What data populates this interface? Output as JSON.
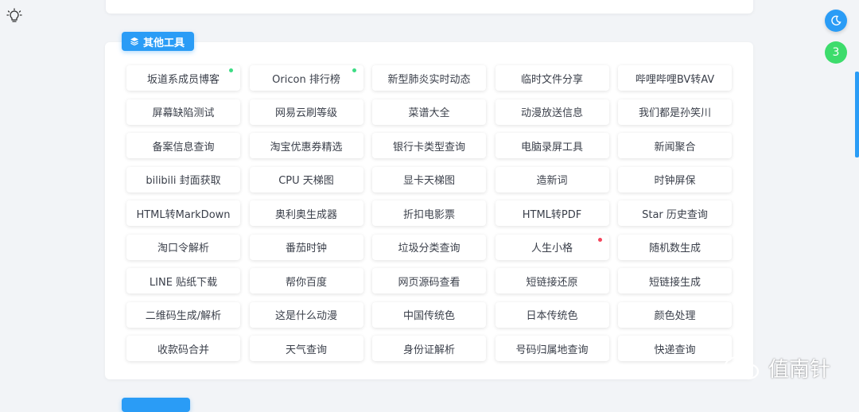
{
  "section": {
    "title": "其他工具",
    "icon": "layers-icon"
  },
  "tools": [
    {
      "label": "坂道系成员博客",
      "dot": "green"
    },
    {
      "label": "Oricon 排行榜",
      "dot": "green"
    },
    {
      "label": "新型肺炎实时动态",
      "dot": ""
    },
    {
      "label": "临时文件分享",
      "dot": ""
    },
    {
      "label": "哔哩哔哩BV转AV",
      "dot": ""
    },
    {
      "label": "屏幕缺陷测试",
      "dot": ""
    },
    {
      "label": "网易云刷等级",
      "dot": ""
    },
    {
      "label": "菜谱大全",
      "dot": ""
    },
    {
      "label": "动漫放送信息",
      "dot": ""
    },
    {
      "label": "我们都是孙笑川",
      "dot": ""
    },
    {
      "label": "备案信息查询",
      "dot": ""
    },
    {
      "label": "淘宝优惠券精选",
      "dot": ""
    },
    {
      "label": "银行卡类型查询",
      "dot": ""
    },
    {
      "label": "电脑录屏工具",
      "dot": ""
    },
    {
      "label": "新闻聚合",
      "dot": ""
    },
    {
      "label": "bilibili 封面获取",
      "dot": ""
    },
    {
      "label": "CPU 天梯图",
      "dot": ""
    },
    {
      "label": "显卡天梯图",
      "dot": ""
    },
    {
      "label": "造新词",
      "dot": ""
    },
    {
      "label": "时钟屏保",
      "dot": ""
    },
    {
      "label": "HTML转MarkDown",
      "dot": ""
    },
    {
      "label": "奥利奥生成器",
      "dot": ""
    },
    {
      "label": "折扣电影票",
      "dot": ""
    },
    {
      "label": "HTML转PDF",
      "dot": ""
    },
    {
      "label": "Star 历史查询",
      "dot": ""
    },
    {
      "label": "淘口令解析",
      "dot": ""
    },
    {
      "label": "番茄时钟",
      "dot": ""
    },
    {
      "label": "垃圾分类查询",
      "dot": ""
    },
    {
      "label": "人生小格",
      "dot": "red"
    },
    {
      "label": "随机数生成",
      "dot": ""
    },
    {
      "label": "LINE 贴纸下载",
      "dot": ""
    },
    {
      "label": "帮你百度",
      "dot": ""
    },
    {
      "label": "网页源码查看",
      "dot": ""
    },
    {
      "label": "短链接还原",
      "dot": ""
    },
    {
      "label": "短链接生成",
      "dot": ""
    },
    {
      "label": "二维码生成/解析",
      "dot": ""
    },
    {
      "label": "这是什么动漫",
      "dot": ""
    },
    {
      "label": "中国传统色",
      "dot": ""
    },
    {
      "label": "日本传统色",
      "dot": ""
    },
    {
      "label": "颜色处理",
      "dot": ""
    },
    {
      "label": "收款码合并",
      "dot": ""
    },
    {
      "label": "天气查询",
      "dot": ""
    },
    {
      "label": "身份证解析",
      "dot": ""
    },
    {
      "label": "号码归属地查询",
      "dot": ""
    },
    {
      "label": "快递查询",
      "dot": ""
    }
  ],
  "float_buttons": {
    "theme_icon": "moon-icon",
    "badge_count": "3"
  },
  "watermark": {
    "text": "值南针",
    "icon": "wechat-icon"
  },
  "colors": {
    "accent": "#2a9cf6",
    "green_dot": "#3ddc84",
    "red_dot": "#f5455c",
    "badge": "#3ddc6c"
  }
}
